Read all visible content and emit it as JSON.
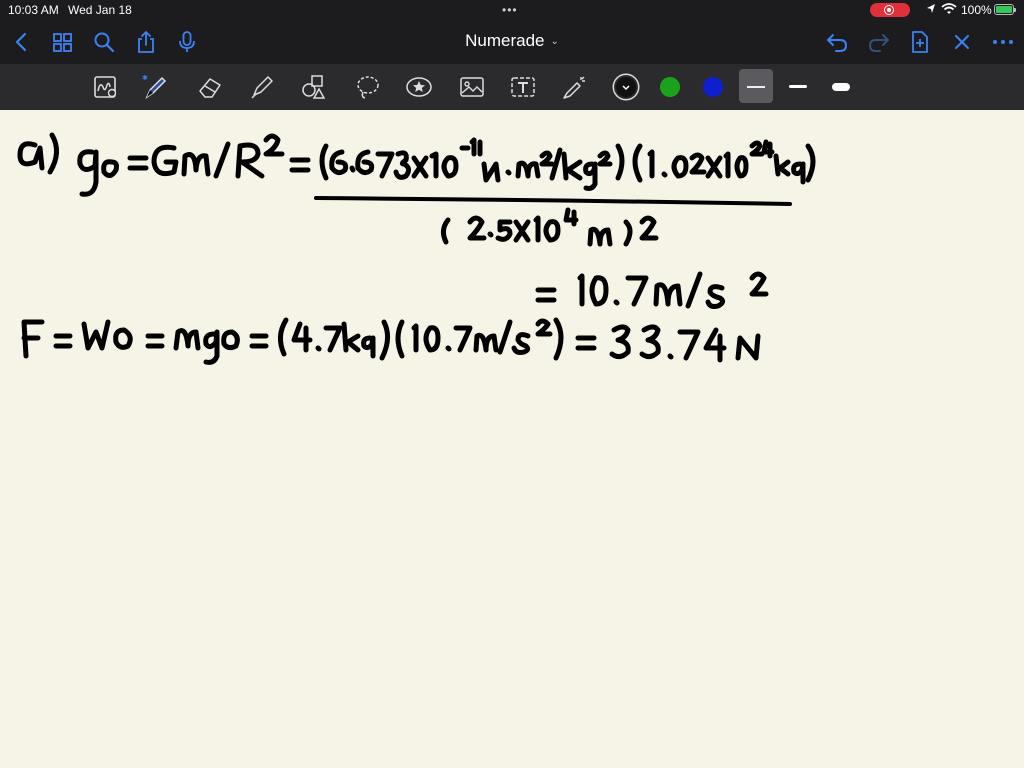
{
  "status_bar": {
    "time": "10:03 AM",
    "date": "Wed Jan 18",
    "battery_text": "100%",
    "battery_level": 1.0,
    "icons": [
      "screen-record-icon",
      "location-icon",
      "wifi-icon",
      "battery-charging-icon"
    ]
  },
  "nav": {
    "title": "Numerade",
    "icons_left": [
      "back-chevron-icon",
      "grid-icon",
      "search-icon",
      "share-icon",
      "microphone-icon"
    ],
    "icons_right": [
      "undo-icon",
      "redo-icon",
      "add-page-icon",
      "close-icon",
      "more-icon"
    ]
  },
  "toolbar": {
    "tools": [
      "lasso-handwriting-icon",
      "pen-icon",
      "eraser-icon",
      "highlighter-icon",
      "shapes-icon",
      "lasso-icon",
      "sticker-icon",
      "image-icon",
      "text-icon",
      "laser-pointer-icon"
    ],
    "colors": [
      "#111111",
      "#1aa31a",
      "#0f1fd0"
    ],
    "selected_color": "#111111",
    "stroke_widths": [
      "thin",
      "medium",
      "thick"
    ],
    "selected_stroke": "thin"
  },
  "canvas": {
    "background": "#f5f4e6",
    "handwriting_lines": [
      "a) g0 = Gm/R^2 = (6.673x10^-11 N·m^2/kg^2)(1.02x10^24 kg) / (2.5x10^4 m)^2",
      "= 10.7 m/s^2",
      "F = W0 = mg0 = (4.7kg)(10.7m/s^2) = 33.74 N"
    ]
  }
}
